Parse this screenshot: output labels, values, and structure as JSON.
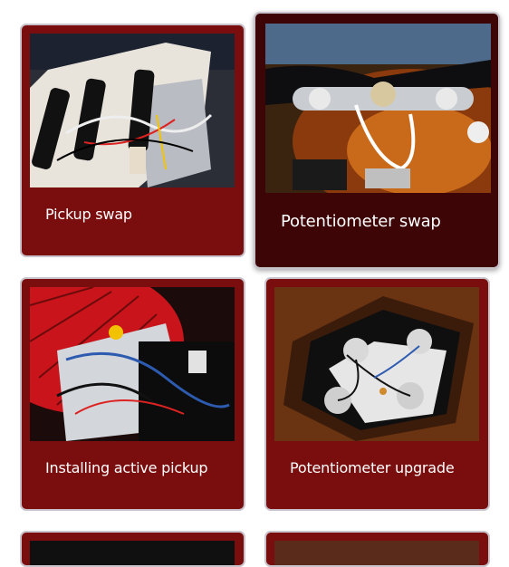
{
  "cards": [
    {
      "title": "Pickup swap",
      "image": "strat-pickguard-wiring-photo"
    },
    {
      "title": "Potentiometer swap",
      "image": "sunburst-control-plate-photo"
    },
    {
      "title": "Installing active pickup",
      "image": "red-guitar-open-pickguard-photo"
    },
    {
      "title": "Potentiometer upgrade",
      "image": "control-cavity-pots-photo"
    },
    {
      "title": "",
      "image": "partial-card-photo"
    },
    {
      "title": "",
      "image": "partial-card-photo"
    }
  ],
  "colors": {
    "card": "#7a0d0d",
    "card_hover": "#3d0505",
    "text": "#ffffff"
  }
}
